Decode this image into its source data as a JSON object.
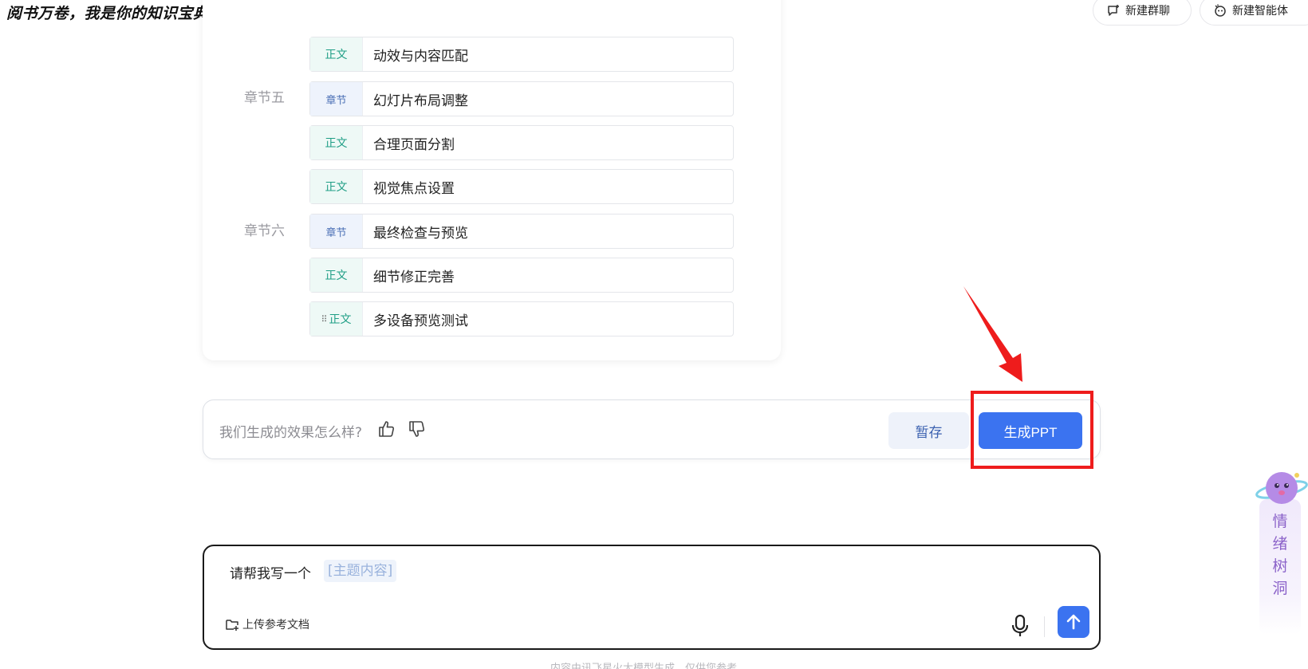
{
  "header": {
    "title": "阅书万卷，我是你的知识宝典",
    "new_group_chat": "新建群聊",
    "new_agent": "新建智能体"
  },
  "outline": {
    "rows": [
      {
        "tag": "正文",
        "type": "body",
        "text": "动效与内容匹配"
      },
      {
        "tag": "章节",
        "type": "chapter",
        "text": "幻灯片布局调整",
        "chapter_label": "章节五"
      },
      {
        "tag": "正文",
        "type": "body",
        "text": "合理页面分割"
      },
      {
        "tag": "正文",
        "type": "body",
        "text": "视觉焦点设置"
      },
      {
        "tag": "章节",
        "type": "chapter",
        "text": "最终检查与预览",
        "chapter_label": "章节六"
      },
      {
        "tag": "正文",
        "type": "body",
        "text": "细节修正完善"
      },
      {
        "tag": "正文",
        "type": "body",
        "text": "多设备预览测试"
      }
    ]
  },
  "feedback": {
    "question": "我们生成的效果怎么样?",
    "save_label": "暂存",
    "generate_label": "生成PPT"
  },
  "input": {
    "prefix": "请帮我写一个",
    "slot": "[主题内容]",
    "upload_label": "上传参考文档"
  },
  "footer": {
    "note": "内容由讯飞星火大模型生成，仅供您参考"
  },
  "mood_widget": {
    "label_chars": [
      "情",
      "绪",
      "树",
      "洞"
    ]
  },
  "colors": {
    "primary": "#3b73f0",
    "highlight": "#ee1c1c",
    "body_tag": "#1f9e85",
    "chapter_tag": "#4a6fb5"
  }
}
